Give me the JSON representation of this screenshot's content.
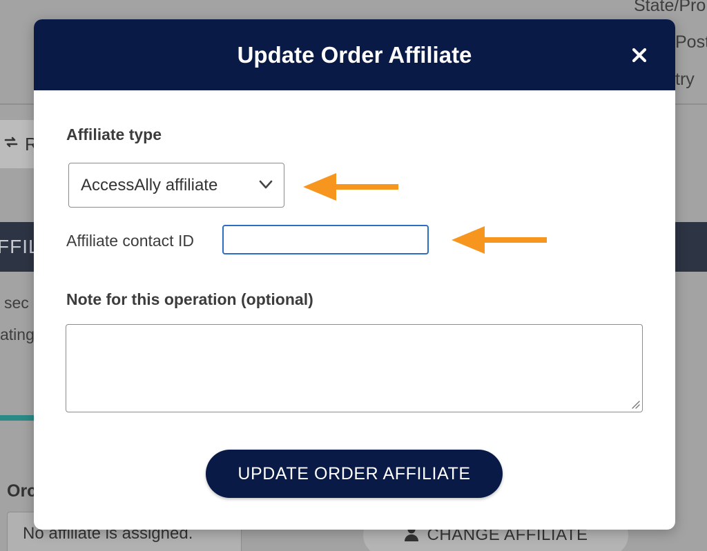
{
  "background": {
    "top_right_fragments": [
      "State/Pro",
      "Posta",
      "try"
    ],
    "refresh_fragment": "R",
    "band_fragment": "FFIL",
    "left_fragments": [
      "sec",
      "ating"
    ],
    "order_heading_fragment": "Orc",
    "affiliate_status": "No affiliate is assigned.",
    "change_affiliate_label": "CHANGE AFFILIATE"
  },
  "modal": {
    "title": "Update Order Affiliate",
    "close_icon": "close-icon",
    "affiliate_type": {
      "label": "Affiliate type",
      "selected": "AccessAlly affiliate"
    },
    "contact_id": {
      "label": "Affiliate contact ID",
      "value": ""
    },
    "note": {
      "label": "Note for this operation (optional)",
      "value": ""
    },
    "submit_label": "UPDATE ORDER AFFILIATE"
  },
  "annotations": {
    "arrow_color": "#f7961e",
    "arrows": [
      "arrow-left-icon",
      "arrow-left-icon"
    ]
  },
  "colors": {
    "header_bg": "#0a1a47",
    "focus_border": "#2b6cc4"
  }
}
